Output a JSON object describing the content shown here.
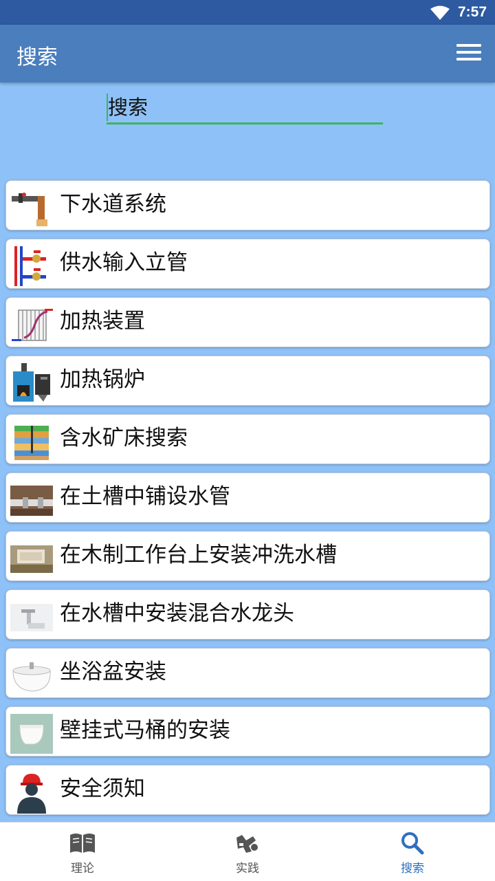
{
  "status_bar": {
    "time": "7:57"
  },
  "app_bar": {
    "title": "搜索"
  },
  "search": {
    "placeholder": "搜索",
    "value": ""
  },
  "items": [
    {
      "label": "下水道系统",
      "icon": "sewer-pipe-icon"
    },
    {
      "label": "供水输入立管",
      "icon": "water-riser-valves-icon"
    },
    {
      "label": "加热装置",
      "icon": "radiator-icon"
    },
    {
      "label": "加热锅炉",
      "icon": "boiler-icon"
    },
    {
      "label": "含水矿床搜索",
      "icon": "aquifer-layers-icon"
    },
    {
      "label": "在土槽中铺设水管",
      "icon": "trench-pipe-photo-icon"
    },
    {
      "label": "在木制工作台上安装冲洗水槽",
      "icon": "sink-install-photo-icon"
    },
    {
      "label": "在水槽中安装混合水龙头",
      "icon": "faucet-photo-icon"
    },
    {
      "label": "坐浴盆安装",
      "icon": "bidet-icon"
    },
    {
      "label": "壁挂式马桶的安装",
      "icon": "wall-toilet-icon"
    },
    {
      "label": "安全须知",
      "icon": "worker-helmet-icon"
    }
  ],
  "bottom_nav": {
    "theory": "理论",
    "practice": "实践",
    "search": "搜索",
    "active": "search",
    "accent": "#2f6fc0"
  }
}
